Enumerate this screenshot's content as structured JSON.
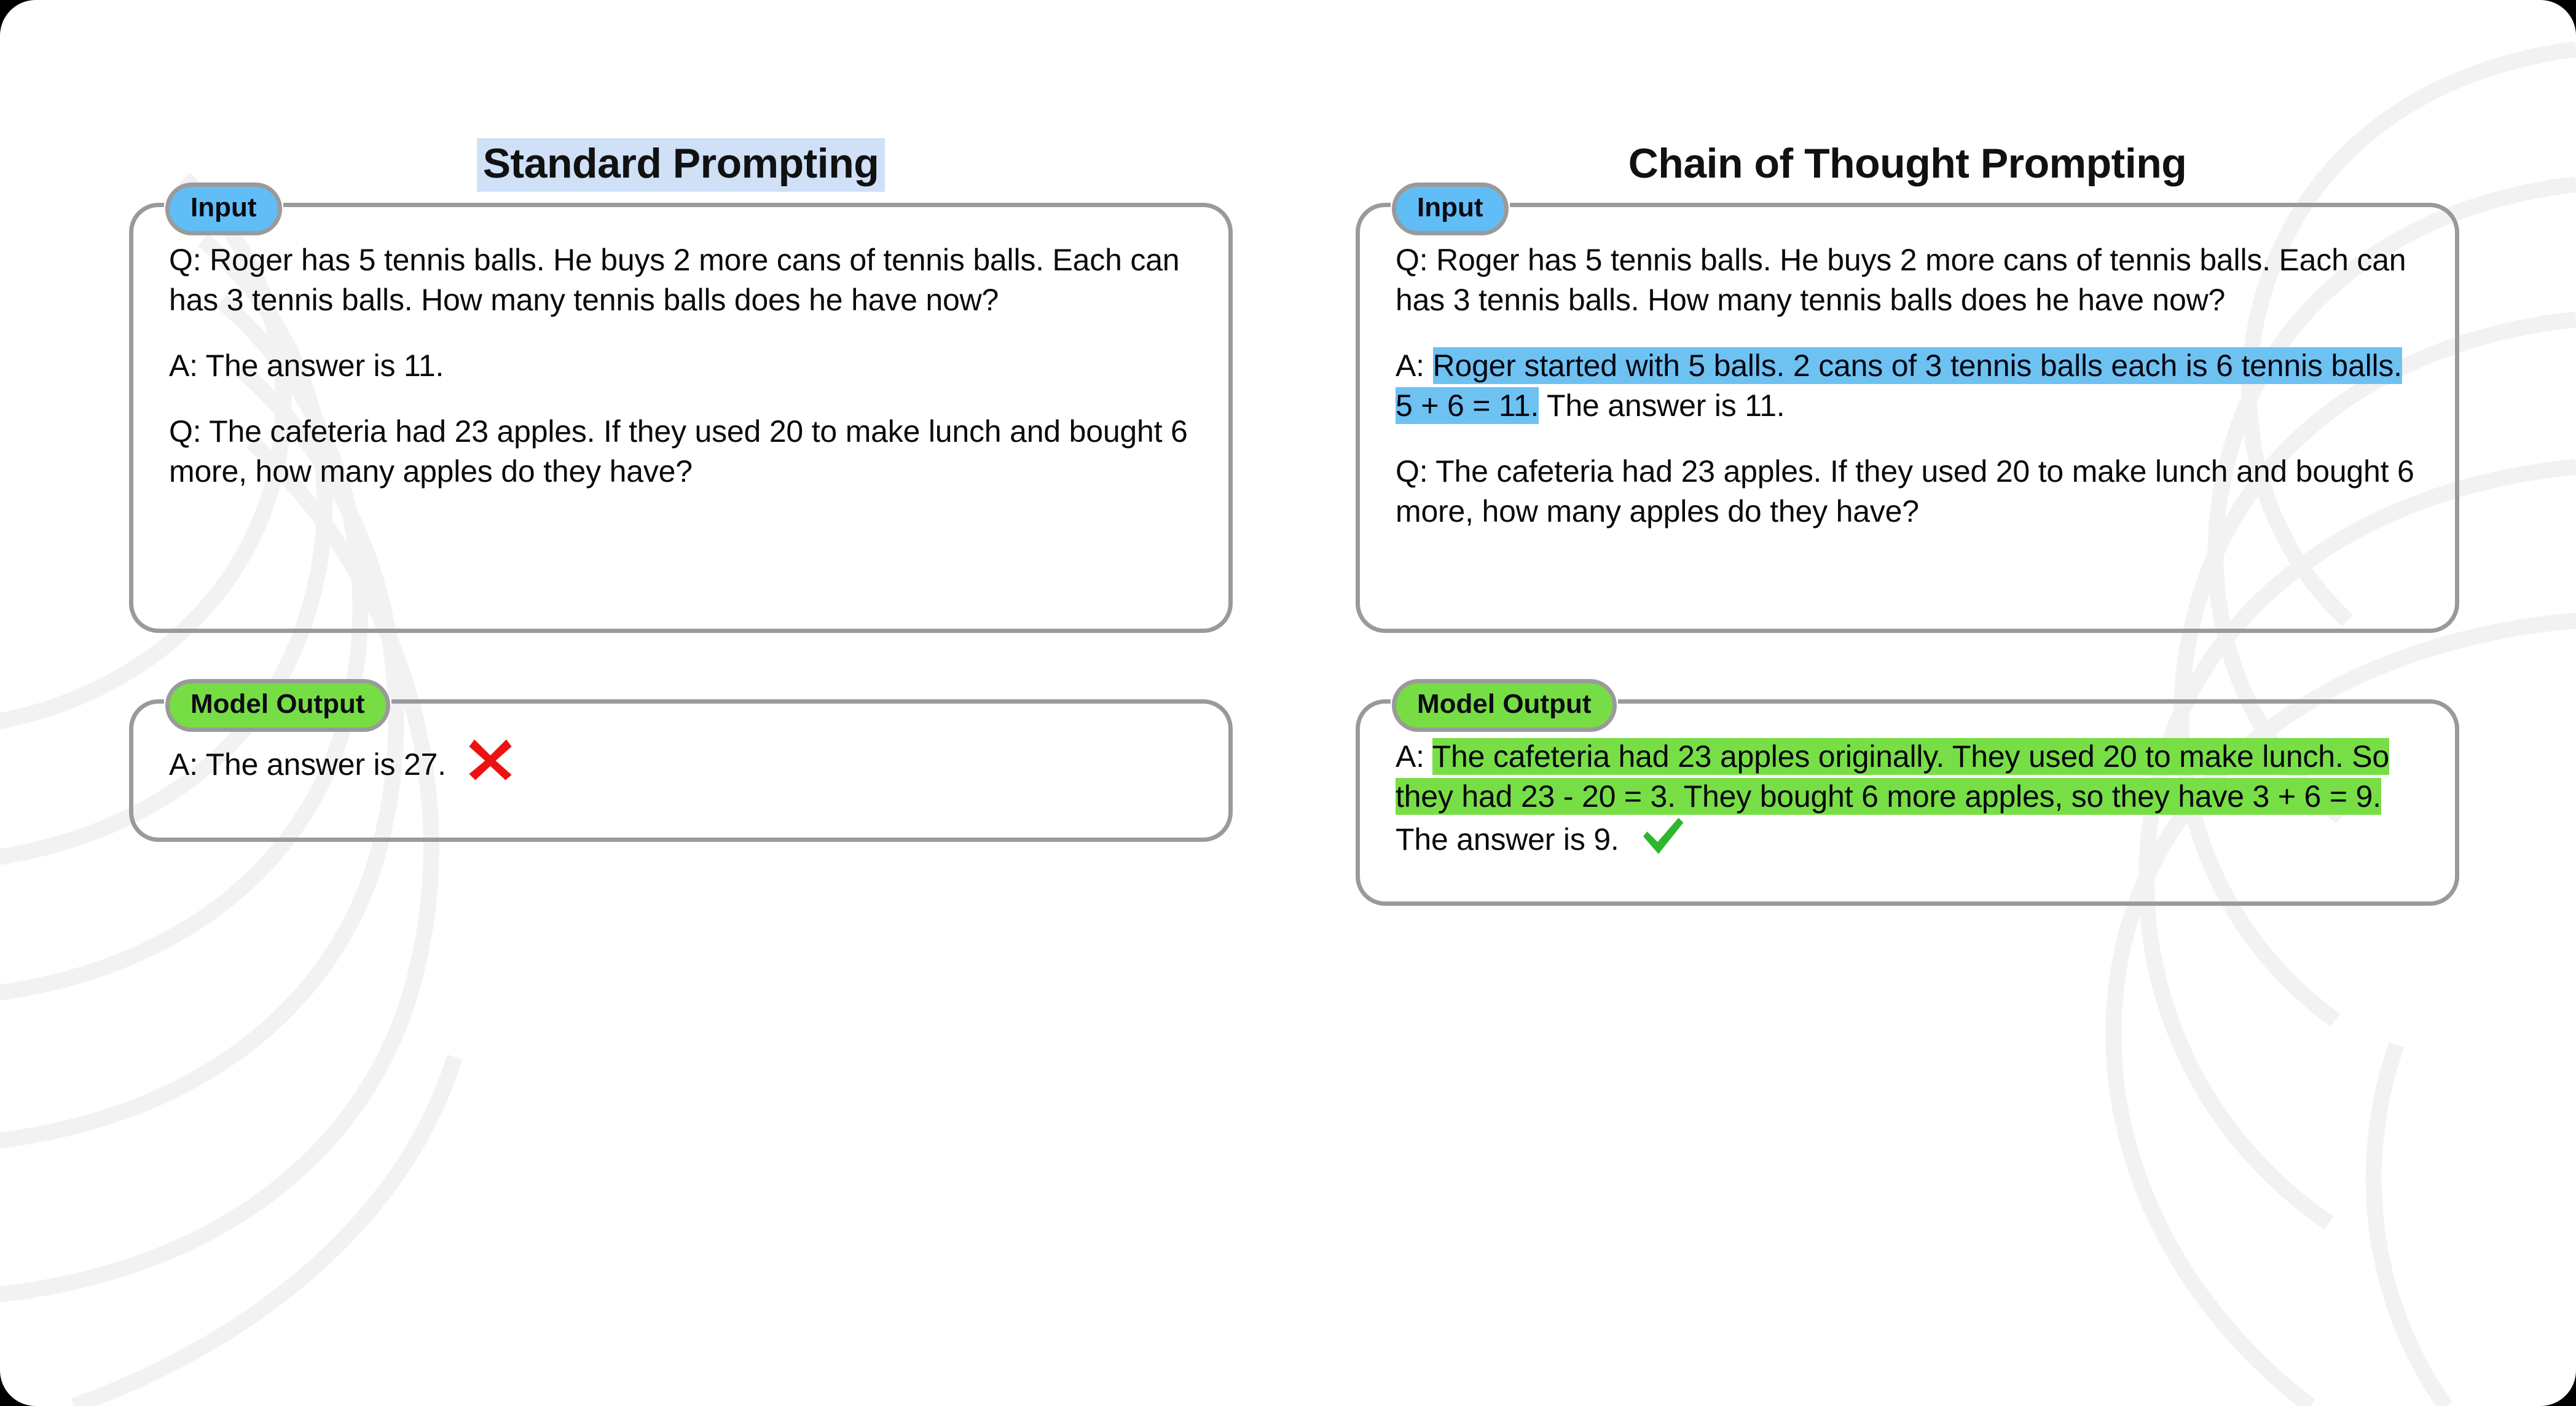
{
  "figure": {
    "title_left": "Standard Prompting",
    "title_right": "Chain of Thought Prompting"
  },
  "colors": {
    "title_highlight": "#cfe0f7",
    "input_badge": "#61bdf5",
    "output_badge": "#77dd44",
    "reasoning_highlight_blue": "#6ec2f2",
    "reasoning_highlight_green": "#78de46",
    "panel_border": "#9a9a9a",
    "cross_red": "#ee1111",
    "check_green": "#2fb62f",
    "page_background": "#ffffff",
    "text": "#0a0a0a"
  },
  "standard": {
    "input": {
      "badge": "Input",
      "badge_icon": "none",
      "blocks": [
        {
          "id": "q1",
          "segments": [
            {
              "text": "Q: Roger has 5 tennis balls. He buys 2 more cans of tennis balls. Each can has 3 tennis balls. How many tennis balls does he have now?",
              "highlight": "none"
            }
          ]
        },
        {
          "id": "a1",
          "segments": [
            {
              "text": "A: The answer is 11.",
              "highlight": "none"
            }
          ]
        },
        {
          "id": "q2",
          "segments": [
            {
              "text": "Q: The cafeteria had 23 apples. If they used 20 to make lunch and bought 6 more, how many apples do they have?",
              "highlight": "none"
            }
          ]
        }
      ]
    },
    "output": {
      "badge": "Model Output",
      "blocks": [
        {
          "id": "a2",
          "segments": [
            {
              "text": "A: The answer is 27.",
              "highlight": "none"
            }
          ],
          "status_icon": "cross-icon",
          "status_meaning": "incorrect"
        }
      ]
    }
  },
  "chain_of_thought": {
    "input": {
      "badge": "Input",
      "blocks": [
        {
          "id": "q1",
          "segments": [
            {
              "text": "Q: Roger has 5 tennis balls. He buys 2 more cans of tennis balls. Each can has 3 tennis balls. How many tennis balls does he have now?",
              "highlight": "none"
            }
          ]
        },
        {
          "id": "a1",
          "segments": [
            {
              "text": "A: ",
              "highlight": "none"
            },
            {
              "text": "Roger started with 5 balls. 2 cans of 3 tennis balls each is 6 tennis balls. 5 + 6 = 11.",
              "highlight": "blue"
            },
            {
              "text": " The answer is 11.",
              "highlight": "none"
            }
          ]
        },
        {
          "id": "q2",
          "segments": [
            {
              "text": "Q: The cafeteria had 23 apples. If they used 20 to make lunch and bought 6 more, how many apples do they have?",
              "highlight": "none"
            }
          ]
        }
      ]
    },
    "output": {
      "badge": "Model Output",
      "blocks": [
        {
          "id": "a2",
          "segments": [
            {
              "text": "A: ",
              "highlight": "none"
            },
            {
              "text": "The cafeteria had 23 apples originally. They used 20 to make lunch. So they had 23 - 20 = 3. They bought 6 more apples, so they have 3 + 6 = 9.",
              "highlight": "green"
            },
            {
              "text": " The answer is 9.",
              "highlight": "none"
            }
          ],
          "status_icon": "check-icon",
          "status_meaning": "correct"
        }
      ]
    }
  }
}
